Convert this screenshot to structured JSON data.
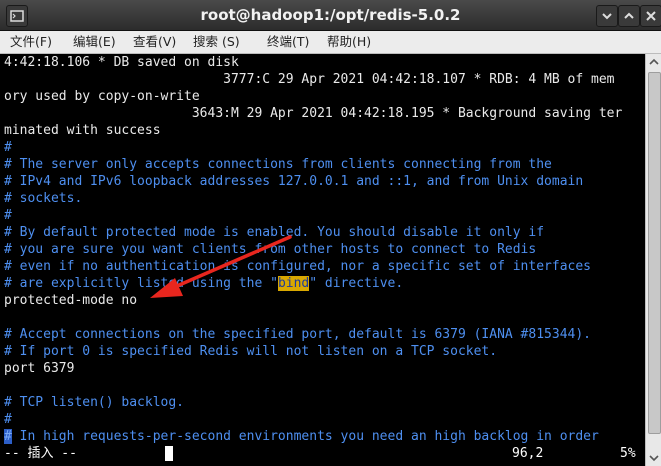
{
  "window": {
    "title": "root@hadoop1:/opt/redis-5.0.2"
  },
  "menu": [
    {
      "label": "文件(F)"
    },
    {
      "label": "编辑(E)"
    },
    {
      "label": "查看(V)"
    },
    {
      "label": "搜索 (S)"
    },
    {
      "label": "终端(T)"
    },
    {
      "label": "帮助(H)"
    }
  ],
  "terminal": {
    "lines": [
      "4:42:18.106 * DB saved on disk",
      "                            3777:C 29 Apr 2021 04:42:18.107 * RDB: 4 MB of mem",
      "ory used by copy-on-write",
      "                        3643:M 29 Apr 2021 04:42:18.195 * Background saving ter",
      "minated with success",
      "#",
      "# The server only accepts connections from clients connecting from the",
      "# IPv4 and IPv6 loopback addresses 127.0.0.1 and ::1, and from Unix domain",
      "# sockets.",
      "#",
      "# By default protected mode is enabled. You should disable it only if",
      "# you are sure you want clients from other hosts to connect to Redis",
      "# even if no authentication is configured, nor a specific set of interfaces",
      "# are explicitly listed using the \"",
      "bind",
      "\" directive.",
      "protected-mode no",
      "",
      "# Accept connections on the specified port, default is 6379 (IANA #815344).",
      "# If port 0 is specified Redis will not listen on a TCP socket.",
      "port 6379",
      "",
      "# TCP listen() backlog.",
      "#",
      "#",
      " In high requests-per-second environments you need an high backlog in order"
    ]
  },
  "statusbar": {
    "mode": "-- 插入 --",
    "position": "96,2",
    "percent": "5%"
  },
  "colors": {
    "comment": "#4e8ff0",
    "highlight": "#d9a800",
    "annotation_arrow": "#e8261e"
  }
}
